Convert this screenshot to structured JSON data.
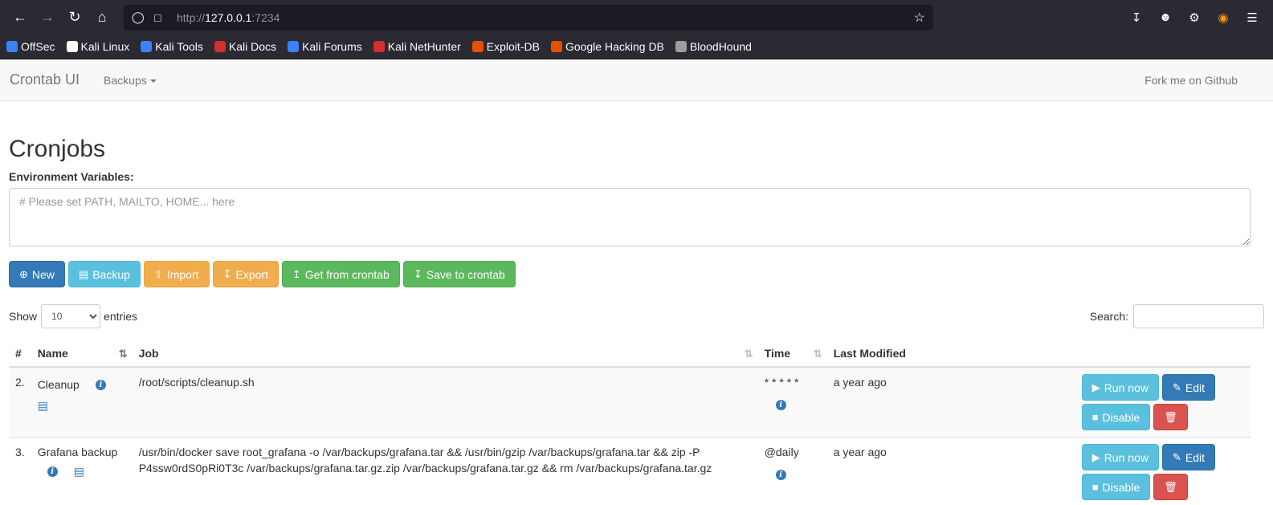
{
  "browser": {
    "url_scheme": "http://",
    "url_host": "127.0.0.1",
    "url_port": ":7234",
    "bookmarks": [
      {
        "label": "OffSec",
        "color": "#3b82f6"
      },
      {
        "label": "Kali Linux",
        "color": "#ffffff"
      },
      {
        "label": "Kali Tools",
        "color": "#3b82f6"
      },
      {
        "label": "Kali Docs",
        "color": "#d32f2f"
      },
      {
        "label": "Kali Forums",
        "color": "#3b82f6"
      },
      {
        "label": "Kali NetHunter",
        "color": "#d32f2f"
      },
      {
        "label": "Exploit-DB",
        "color": "#e65100"
      },
      {
        "label": "Google Hacking DB",
        "color": "#e65100"
      },
      {
        "label": "BloodHound",
        "color": "#9e9e9e"
      }
    ]
  },
  "navbar": {
    "brand": "Crontab UI",
    "backups": "Backups",
    "fork": "Fork me on Github"
  },
  "page": {
    "title": "Cronjobs",
    "env_label": "Environment Variables:",
    "env_placeholder": "# Please set PATH, MAILTO, HOME... here"
  },
  "buttons": {
    "new": "New",
    "backup": "Backup",
    "import": "Import",
    "export": "Export",
    "get_from_crontab": "Get from crontab",
    "save_to_crontab": "Save to crontab"
  },
  "table_controls": {
    "show": "Show",
    "entries_value": "10",
    "entries": "entries",
    "search": "Search:"
  },
  "table": {
    "headers": [
      "#",
      "Name",
      "Job",
      "Time",
      "Last Modified"
    ],
    "rows": [
      {
        "num": "2.",
        "name": "Cleanup",
        "job": "/root/scripts/cleanup.sh",
        "time": "* * * * *",
        "modified": "a year ago"
      },
      {
        "num": "3.",
        "name": "Grafana backup",
        "job": "/usr/bin/docker save root_grafana -o /var/backups/grafana.tar && /usr/bin/gzip /var/backups/grafana.tar && zip -P P4ssw0rdS0pRi0T3c /var/backups/grafana.tar.gz.zip /var/backups/grafana.tar.gz && rm /var/backups/grafana.tar.gz",
        "time": "@daily",
        "modified": "a year ago"
      }
    ],
    "row_actions": {
      "run_now": "Run now",
      "edit": "Edit",
      "disable": "Disable"
    }
  },
  "icons": {
    "back": "back-arrow-icon",
    "forward": "forward-arrow-icon",
    "reload": "reload-icon",
    "home": "home-icon",
    "shield": "shield-icon",
    "page": "page-icon",
    "star": "star-icon",
    "download": "download-icon",
    "account": "account-icon",
    "extensions": "extensions-icon",
    "firefox": "firefox-icon",
    "menu": "menu-icon",
    "info": "info-icon",
    "save": "save-icon",
    "trash": "trash-icon",
    "play": "play-icon",
    "edit": "edit-icon",
    "stop": "stop-icon"
  }
}
